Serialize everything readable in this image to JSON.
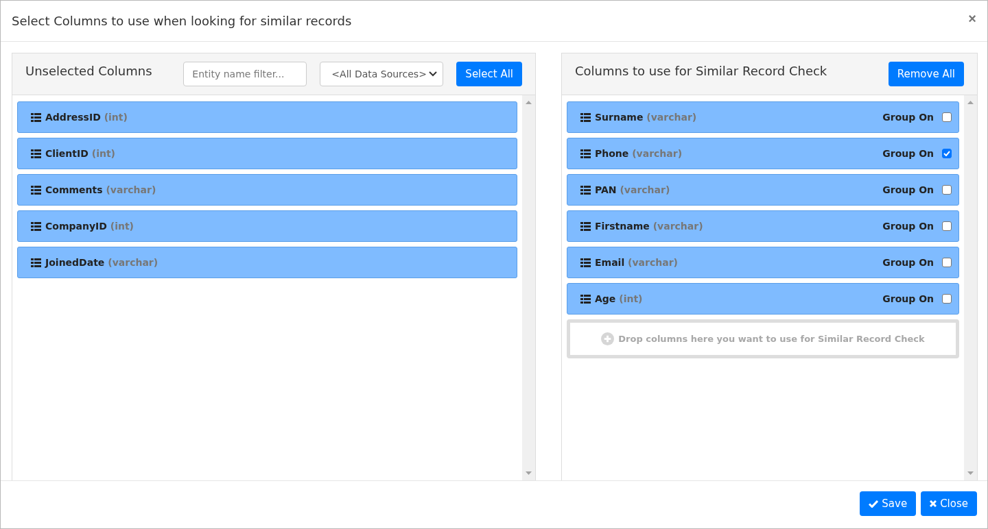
{
  "dialog": {
    "title": "Select Columns to use when looking for similar records",
    "close_glyph": "×"
  },
  "unselected": {
    "title": "Unselected Columns",
    "filter": {
      "placeholder": "Entity name filter..."
    },
    "source_select": "<All Data Sources>",
    "select_all": "Select All",
    "columns": [
      {
        "name": "AddressID",
        "type": "(int)"
      },
      {
        "name": "ClientID",
        "type": "(int)"
      },
      {
        "name": "Comments",
        "type": "(varchar)"
      },
      {
        "name": "CompanyID",
        "type": "(int)"
      },
      {
        "name": "JoinedDate",
        "type": "(varchar)"
      }
    ]
  },
  "selected": {
    "title": "Columns to use for Similar Record Check",
    "remove_all": "Remove All",
    "columns": [
      {
        "name": "Surname",
        "type": "(varchar)",
        "group_label": "Group On",
        "checked": false
      },
      {
        "name": "Phone",
        "type": "(varchar)",
        "group_label": "Group On",
        "checked": true
      },
      {
        "name": "PAN",
        "type": "(varchar)",
        "group_label": "Group On",
        "checked": false
      },
      {
        "name": "Firstname",
        "type": "(varchar)",
        "group_label": "Group On",
        "checked": false
      },
      {
        "name": "Email",
        "type": "(varchar)",
        "group_label": "Group On",
        "checked": false
      },
      {
        "name": "Age",
        "type": "(int)",
        "group_label": "Group On",
        "checked": false
      }
    ],
    "drop_hint": "Drop columns here you want to use for Similar Record Check"
  },
  "footer": {
    "save": "Save",
    "close": "Close"
  }
}
